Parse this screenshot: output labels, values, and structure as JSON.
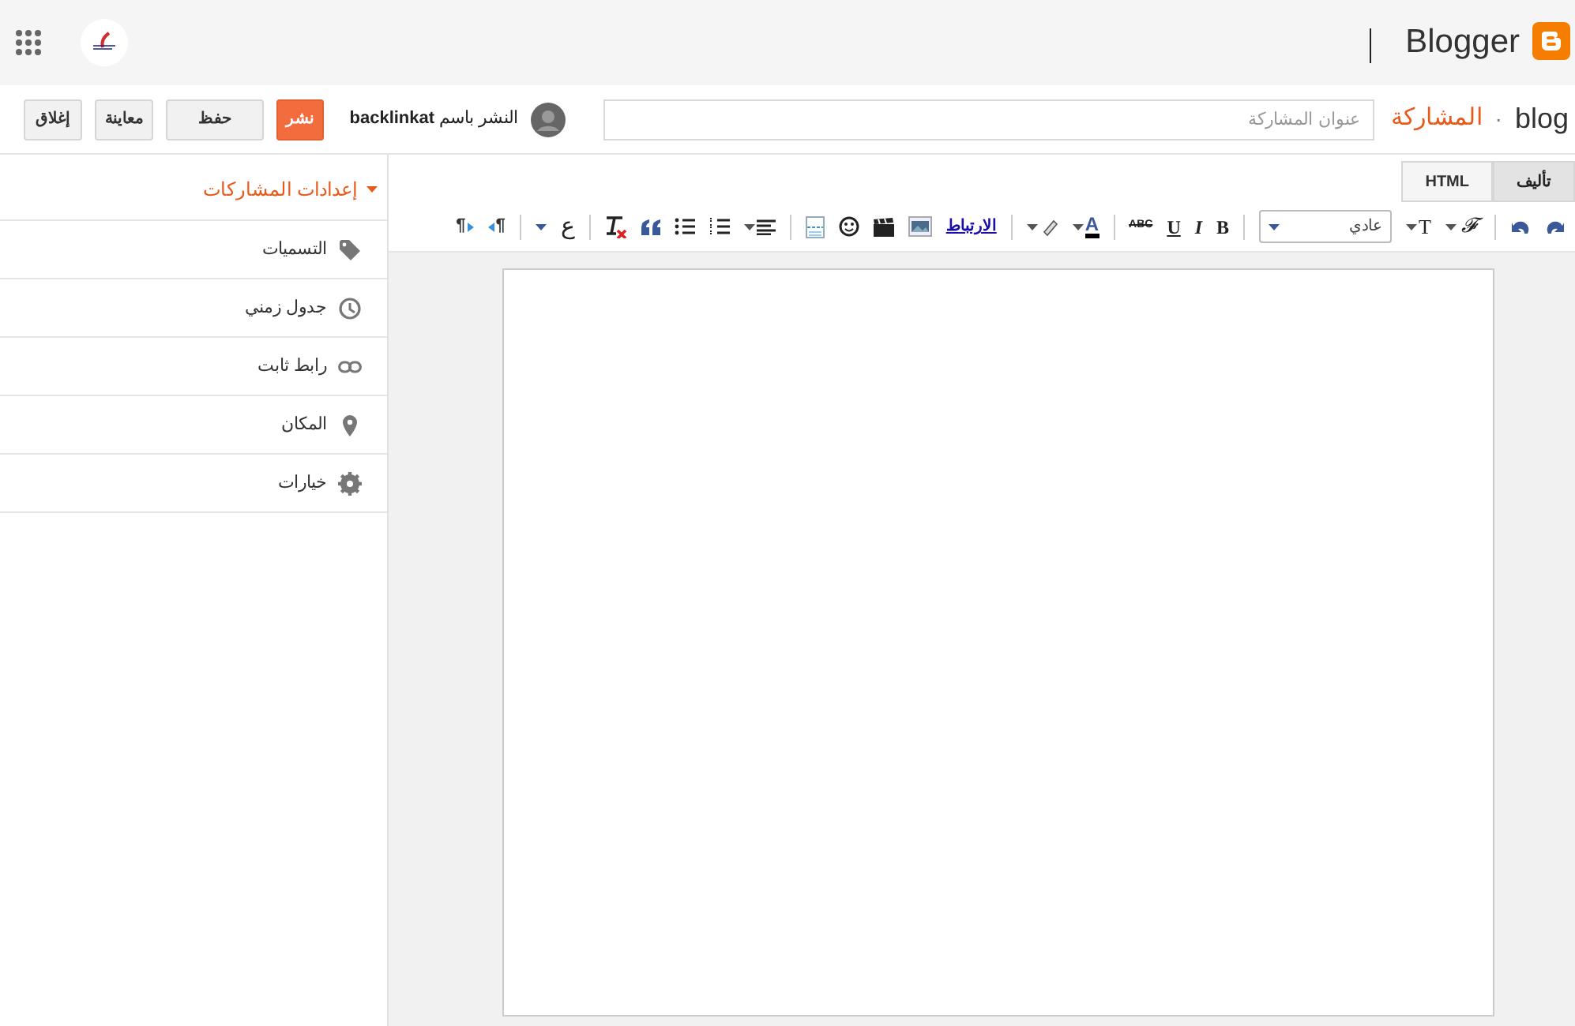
{
  "header": {
    "product": "Blogger"
  },
  "post_bar": {
    "blog": "blog",
    "separator": "·",
    "section": "المشاركة",
    "title_placeholder": "عنوان المشاركة",
    "publish_as": "النشر باسم **backlinkat**",
    "buttons": [
      {
        "label": "نشر",
        "kind": "primary"
      },
      {
        "label": "حفظ",
        "kind": "plain"
      },
      {
        "label": "معاينة",
        "kind": "plain"
      },
      {
        "label": "إغلاق",
        "kind": "plain"
      }
    ]
  },
  "sidebar": {
    "title": "إعدادات المشاركات",
    "expanded": true,
    "items": [
      {
        "label": "التسميات"
      },
      {
        "label": "جدول زمني"
      },
      {
        "label": "رابط ثابت"
      },
      {
        "label": "المكان"
      },
      {
        "label": "خيارات"
      }
    ]
  },
  "editor": {
    "tabs": [
      {
        "label": "تأليف",
        "selected": true
      },
      {
        "label": "HTML",
        "selected": false
      }
    ],
    "toolbar": {
      "font": "𝓕",
      "size": "T",
      "format": "عادي",
      "bold": "B",
      "italic": "I",
      "underline": "U",
      "strike": "ABC",
      "text_color": "A",
      "link": "الارتباط",
      "direction": "ع",
      "rtl_mark": "¶",
      "ltr_mark": "¶"
    }
  }
}
